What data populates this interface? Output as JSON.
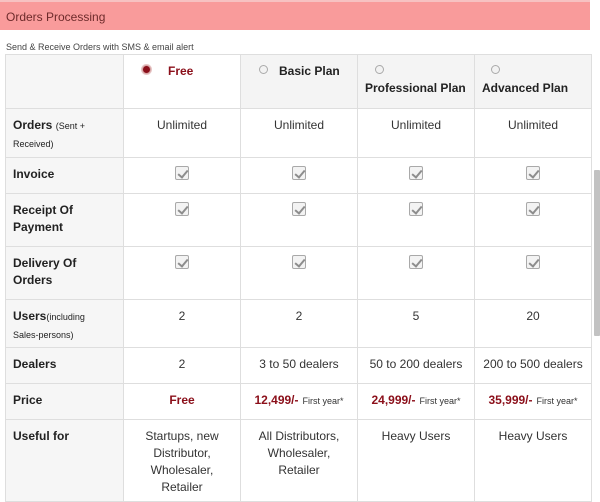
{
  "header": {
    "title": "Orders Processing"
  },
  "subtitle": "Send & Receive Orders with SMS & email alert",
  "plans": [
    {
      "name": "Free",
      "selected": true
    },
    {
      "name": "Basic Plan",
      "selected": false
    },
    {
      "name": "Professional Plan",
      "selected": false
    },
    {
      "name": "Advanced Plan",
      "selected": false
    }
  ],
  "rows": {
    "orders": {
      "label": "Orders",
      "note": "(Sent + Received)",
      "values": [
        "Unlimited",
        "Unlimited",
        "Unlimited",
        "Unlimited"
      ]
    },
    "invoice": {
      "label": "Invoice"
    },
    "receipt": {
      "label_line1": "Receipt Of",
      "label_line2": "Payment"
    },
    "delivery": {
      "label_line1": "Delivery Of",
      "label_line2": "Orders"
    },
    "users": {
      "label": "Users",
      "note_line1": "(including",
      "note_line2": "Sales-persons)",
      "values": [
        "2",
        "2",
        "5",
        "20"
      ]
    },
    "dealers": {
      "label": "Dealers",
      "values": [
        "2",
        "3 to 50 dealers",
        "50 to 200 dealers",
        "200 to 500 dealers"
      ]
    },
    "price": {
      "label": "Price",
      "free": "Free",
      "values": [
        "12,499/-",
        "24,999/-",
        "35,999/-"
      ],
      "note": "First year*"
    },
    "useful": {
      "label": "Useful for",
      "free_lines": [
        "Startups, new",
        "Distributor,",
        "Wholesaler,",
        "Retailer"
      ],
      "basic_lines": [
        "All Distributors,",
        "Wholesaler,",
        "Retailer"
      ],
      "professional": "Heavy Users",
      "advanced": "Heavy Users"
    }
  },
  "colors": {
    "accent": "#8b0f1a",
    "header_bg": "#f99b9b"
  }
}
